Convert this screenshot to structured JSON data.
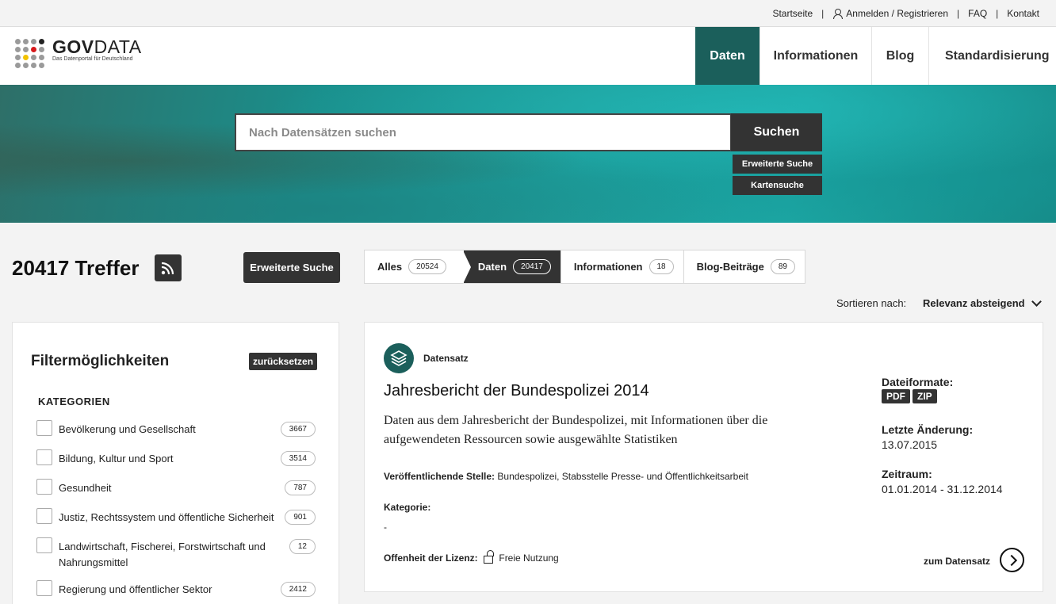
{
  "topbar": {
    "startseite": "Startseite",
    "anmelden": "Anmelden / Registrieren",
    "faq": "FAQ",
    "kontakt": "Kontakt"
  },
  "logo": {
    "gov": "GOV",
    "data": "DATA",
    "subtitle": "Das Datenportal für Deutschland",
    "dot_colors": [
      "#9a9a9a",
      "#9a9a9a",
      "#9a9a9a",
      "#222222",
      "#9a9a9a",
      "#9a9a9a",
      "#d7191c",
      "#9a9a9a",
      "#9a9a9a",
      "#f2c200",
      "#9a9a9a",
      "#9a9a9a",
      "#9a9a9a",
      "#9a9a9a",
      "#9a9a9a",
      "#9a9a9a"
    ]
  },
  "nav": [
    {
      "label": "Daten",
      "active": true
    },
    {
      "label": "Informationen",
      "active": false
    },
    {
      "label": "Blog",
      "active": false
    },
    {
      "label": "Standardisierung",
      "active": false
    }
  ],
  "hero": {
    "search_placeholder": "Nach Datensätzen suchen",
    "search_button": "Suchen",
    "advanced_link": "Erweiterte Suche",
    "map_link": "Kartensuche"
  },
  "results": {
    "hits": "20417 Treffer",
    "advanced_button": "Erweiterte Suche",
    "tabs": [
      {
        "label": "Alles",
        "count": "20524"
      },
      {
        "label": "Daten",
        "count": "20417"
      },
      {
        "label": "Informationen",
        "count": "18"
      },
      {
        "label": "Blog-Beiträge",
        "count": "89"
      }
    ],
    "sort_label": "Sortieren nach:",
    "sort_value": "Relevanz absteigend"
  },
  "filter": {
    "title": "Filtermöglichkeiten",
    "reset": "zurücksetzen",
    "heading": "KATEGORIEN",
    "categories": [
      {
        "label": "Bevölkerung und Gesellschaft",
        "count": "3667"
      },
      {
        "label": "Bildung, Kultur und Sport",
        "count": "3514"
      },
      {
        "label": "Gesundheit",
        "count": "787"
      },
      {
        "label": "Justiz, Rechtssystem und öffentliche Sicherheit",
        "count": "901"
      },
      {
        "label": "Landwirtschaft, Fischerei, Forstwirtschaft und Nahrungsmittel",
        "count": "12"
      },
      {
        "label": "Regierung und öffentlicher Sektor",
        "count": "2412"
      }
    ]
  },
  "dataset": {
    "type": "Datensatz",
    "title": "Jahresbericht der Bundespolizei 2014",
    "description": "Daten aus dem Jahresbericht der Bundespolizei, mit Informationen über die aufgewendeten Ressourcen sowie ausgewählte Statistiken",
    "publisher_label": "Veröffentlichende Stelle:",
    "publisher": "Bundespolizei, Stabsstelle Presse- und Öffentlichkeitsarbeit",
    "category_label": "Kategorie:",
    "category": "-",
    "license_label": "Offenheit der Lizenz:",
    "license": "Freie Nutzung",
    "formats_label": "Dateiformate:",
    "formats": [
      "PDF",
      "ZIP"
    ],
    "changed_label": "Letzte Änderung:",
    "changed": "13.07.2015",
    "period_label": "Zeitraum:",
    "period": "01.01.2014 - 31.12.2014",
    "link": "zum Datensatz"
  },
  "colors": {
    "accent": "#1b5f5b",
    "dark": "#333333"
  }
}
